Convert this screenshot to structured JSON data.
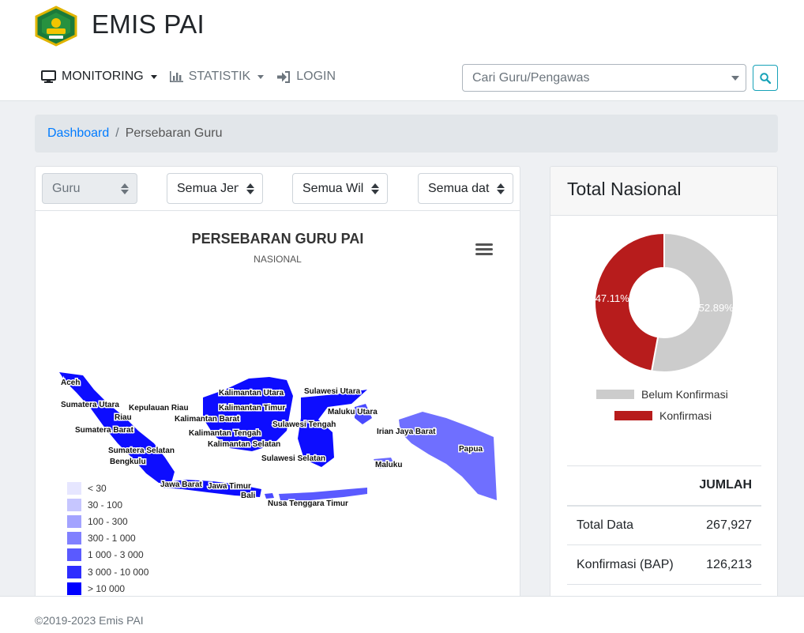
{
  "app": {
    "title": "EMIS PAI",
    "logo_icon": "kemenag-logo-icon"
  },
  "nav": {
    "items": [
      {
        "label": "MONITORING",
        "icon": "monitor-icon",
        "active": true
      },
      {
        "label": "STATISTIK",
        "icon": "bar-chart-icon",
        "active": false
      },
      {
        "label": "LOGIN",
        "icon": "sign-in-icon",
        "active": false
      }
    ]
  },
  "search": {
    "placeholder": "Cari Guru/Pengawas",
    "button_icon": "search-icon"
  },
  "breadcrumb": {
    "home": "Dashboard",
    "current": "Persebaran Guru"
  },
  "filters": [
    {
      "value": "Guru",
      "disabled": true
    },
    {
      "value": "Semua Jenjang",
      "disabled": false
    },
    {
      "value": "Semua Wilayah",
      "disabled": false
    },
    {
      "value": "Semua data",
      "disabled": false
    }
  ],
  "map": {
    "title": "PERSEBARAN GURU PAI",
    "subtitle": "NASIONAL",
    "menu_icon": "hamburger-menu-icon",
    "region_labels": [
      "Aceh",
      "Sumatera Utara",
      "Kepulauan Riau",
      "Riau",
      "Sumatera Barat",
      "Sumatera Selatan",
      "Bengkulu",
      "Kalimantan Utara",
      "Kalimantan Timur",
      "Kalimantan Barat",
      "Kalimantan Tengah",
      "Kalimantan Selatan",
      "Sulawesi Utara",
      "Maluku Utara",
      "Sulawesi Tengah",
      "Sulawesi Selatan",
      "Irian Jaya Barat",
      "Papua",
      "Maluku",
      "Jawa Barat",
      "Jawa Timur",
      "Bali",
      "Nusa Tenggara Timur"
    ],
    "legend": [
      {
        "label": "< 30",
        "color": "#e6e6ff"
      },
      {
        "label": "30 - 100",
        "color": "#c6c6ff"
      },
      {
        "label": "100 - 300",
        "color": "#a3a3ff"
      },
      {
        "label": "300 - 1 000",
        "color": "#8080ff"
      },
      {
        "label": "1 000 - 3 000",
        "color": "#5a5aff"
      },
      {
        "label": "3 000 - 10 000",
        "color": "#2d2dff"
      },
      {
        "label": "> 10 000",
        "color": "#0000ff"
      }
    ]
  },
  "total": {
    "title": "Total Nasional",
    "chart_data": {
      "type": "pie",
      "categories": [
        "Belum Konfirmasi",
        "Konfirmasi"
      ],
      "values": [
        52.89,
        47.11
      ],
      "data_labels": [
        "52.89%",
        "47.11%"
      ],
      "colors": [
        "#cccccc",
        "#b71c1c"
      ],
      "legend_position": "bottom"
    },
    "table": {
      "header": "JUMLAH",
      "rows": [
        {
          "label": "Total Data",
          "value": "267,927"
        },
        {
          "label": "Konfirmasi (BAP)",
          "value": "126,213"
        }
      ]
    }
  },
  "footer": {
    "text": "©2019-2023 Emis PAI"
  }
}
